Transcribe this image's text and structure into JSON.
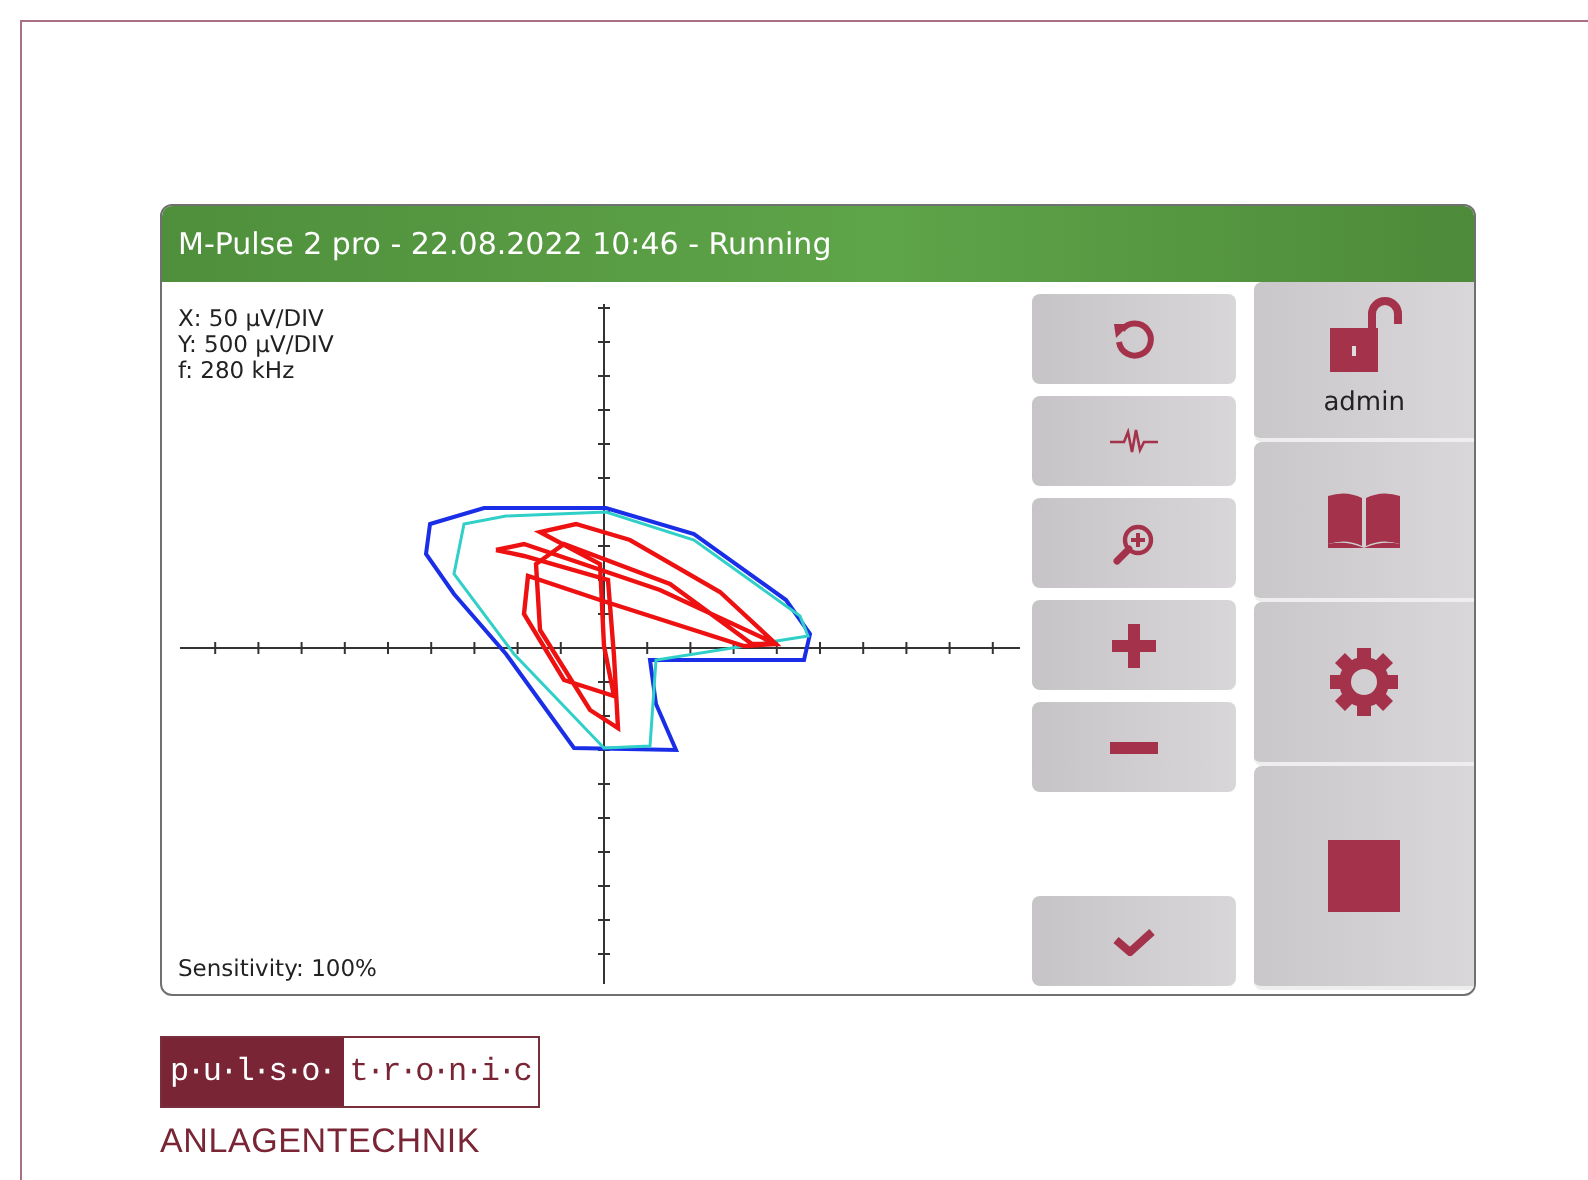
{
  "window": {
    "title": "M-Pulse 2 pro - 22.08.2022 10:46 - Running"
  },
  "plot": {
    "scale_lines": [
      "X: 50 µV/DIV",
      "Y: 500 µV/DIV",
      "f: 280 kHz"
    ],
    "sensitivity": "Sensitivity: 100%"
  },
  "side_panel": {
    "user_label": "admin"
  },
  "logo": {
    "left": "p·u·l·s·o·",
    "right": "t·r·o·n·i·c",
    "subtitle": "ANLAGENTECHNIK"
  }
}
